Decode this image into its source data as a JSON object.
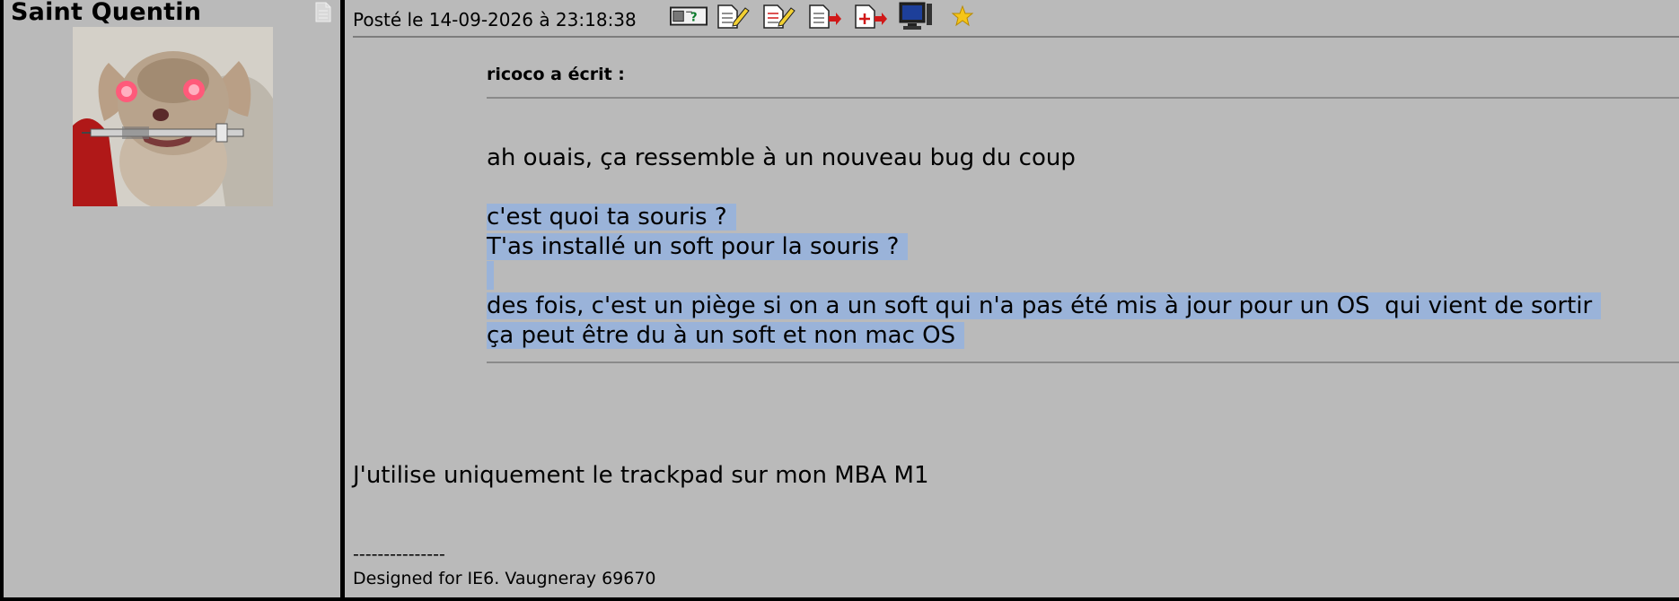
{
  "author": {
    "name": "Saint Quentin",
    "avatar_icon": "dog-avatar-image",
    "profile_icon": "profile-page-icon"
  },
  "post": {
    "date_text": "Posté le 14-09-2026 à 23:18:38",
    "toolbar": [
      {
        "icon": "profile-card-icon"
      },
      {
        "icon": "edit-icon"
      },
      {
        "icon": "edit-multi-icon"
      },
      {
        "icon": "quote-icon"
      },
      {
        "icon": "quote-add-icon"
      },
      {
        "icon": "monitor-icon"
      },
      {
        "icon": "star-icon"
      }
    ],
    "quote": {
      "author_label": "ricoco a écrit :",
      "lines": [
        "ah ouais, ça ressemble à un nouveau bug du coup",
        "c'est quoi ta souris ?",
        "T'as installé un soft pour la souris ?",
        "des fois, c'est un piège si on a un soft qui n'a pas été mis à jour pour un OS  qui vient de sortir",
        "ça peut être du à un soft et non mac OS"
      ]
    },
    "reply": "J'utilise uniquement le trackpad sur mon MBA M1",
    "signature": {
      "separator": "---------------",
      "text": "Designed for IE6. Vaugneray 69670"
    }
  },
  "colors": {
    "background": "#bababa",
    "selection": "#9ab3d9",
    "border": "#000000"
  }
}
